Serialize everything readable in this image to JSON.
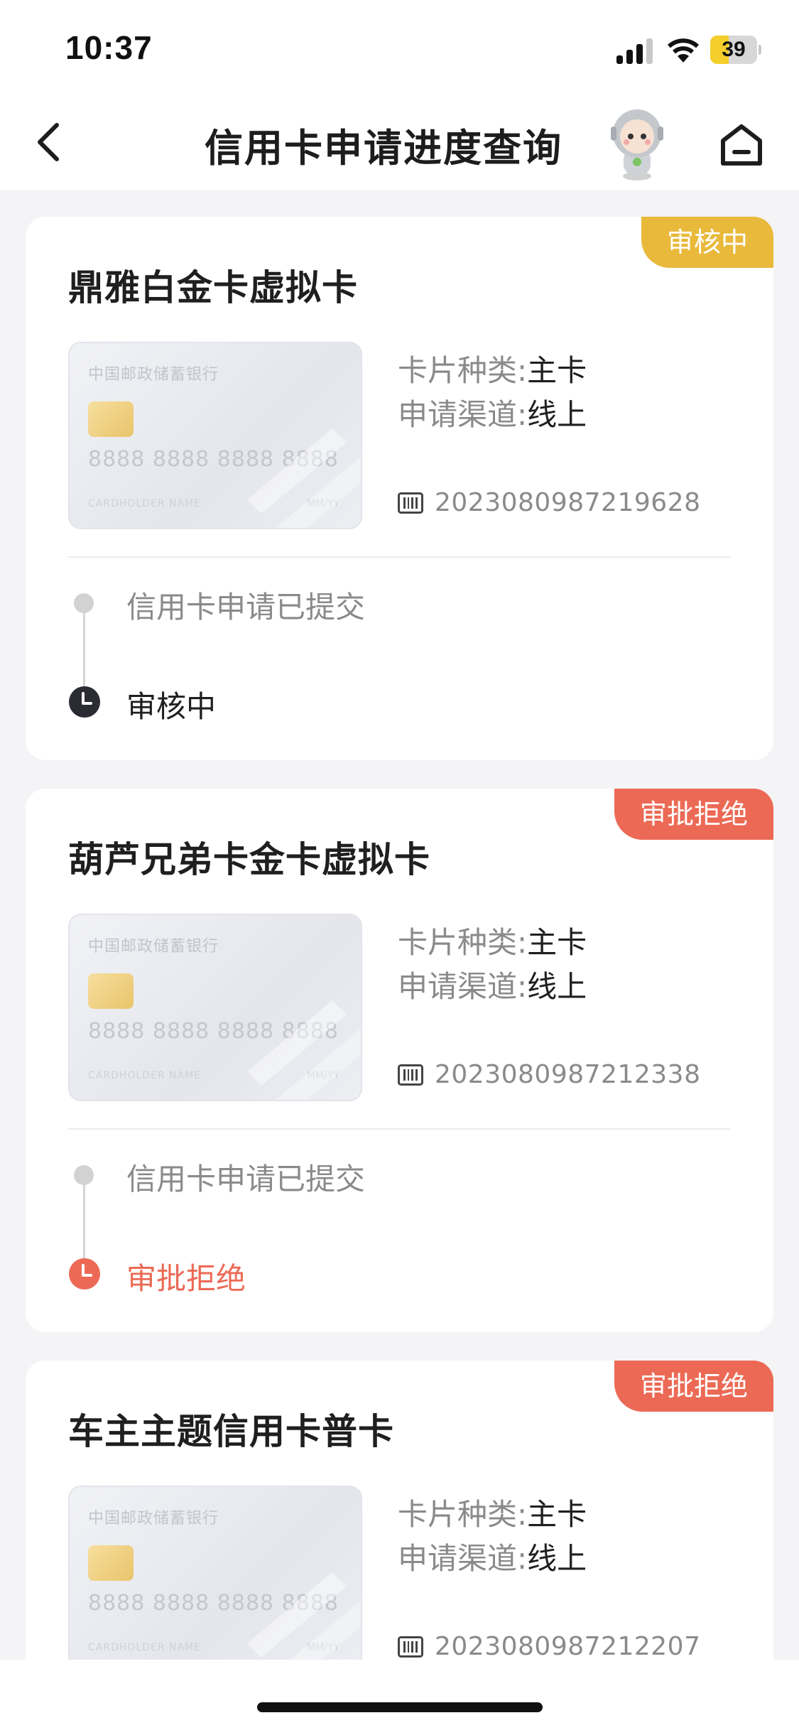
{
  "status_bar": {
    "time": "10:37",
    "battery": "39",
    "battery_level": 0.39
  },
  "nav": {
    "title": "信用卡申请进度查询"
  },
  "colors": {
    "reviewing": "#e8b93b",
    "rejected": "#ec6a55",
    "reviewing_dot": "#2b2b33"
  },
  "applications": [
    {
      "name": "鼎雅白金卡虚拟卡",
      "status_tag": "审核中",
      "status_type": "reviewing",
      "card_face": {
        "bank_name": "中国邮政储蓄银行",
        "number": "8888 8888 8888 8888",
        "holder": "CARDHOLDER NAME",
        "expiry": "MM/YY"
      },
      "card_type_label": "卡片种类:",
      "card_type_value": "主卡",
      "channel_label": "申请渠道:",
      "channel_value": "线上",
      "application_number": "2023080987219628",
      "steps": [
        "信用卡申请已提交",
        "审核中"
      ]
    },
    {
      "name": "葫芦兄弟卡金卡虚拟卡",
      "status_tag": "审批拒绝",
      "status_type": "rejected",
      "card_face": {
        "bank_name": "中国邮政储蓄银行",
        "number": "8888 8888 8888 8888",
        "holder": "CARDHOLDER NAME",
        "expiry": "MM/YY"
      },
      "card_type_label": "卡片种类:",
      "card_type_value": "主卡",
      "channel_label": "申请渠道:",
      "channel_value": "线上",
      "application_number": "2023080987212338",
      "steps": [
        "信用卡申请已提交",
        "审批拒绝"
      ]
    },
    {
      "name": "车主主题信用卡普卡",
      "status_tag": "审批拒绝",
      "status_type": "rejected",
      "card_face": {
        "bank_name": "中国邮政储蓄银行",
        "number": "8888 8888 8888 8888",
        "holder": "CARDHOLDER NAME",
        "expiry": "MM/YY"
      },
      "card_type_label": "卡片种类:",
      "card_type_value": "主卡",
      "channel_label": "申请渠道:",
      "channel_value": "线上",
      "application_number": "2023080987212207",
      "steps": []
    }
  ]
}
